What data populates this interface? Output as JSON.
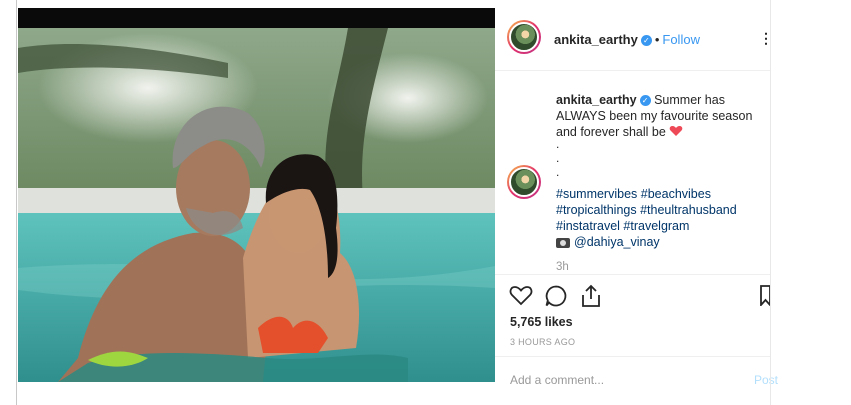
{
  "post": {
    "username": "ankita_earthy",
    "verified": true,
    "follow_label": "Follow",
    "separator": "•",
    "more_glyph": "⋮",
    "caption_text": "Summer has ALWAYS been my favourite season and forever shall be",
    "caption_emoji": "heart-emoji",
    "dots": [
      ".",
      ".",
      "."
    ],
    "hashtags": [
      "#summervibes",
      "#beachvibes",
      "#tropicalthings",
      "#theultrahusband",
      "#instatravel",
      "#travelgram"
    ],
    "photo_credit": "@dahiya_vinay",
    "comment_age": "3h",
    "likes": "5,765 likes",
    "timestamp": "3 HOURS AGO",
    "comment_placeholder": "Add a comment...",
    "post_label": "Post"
  },
  "colors": {
    "link": "#3897f0",
    "hashtag": "#003569",
    "muted": "#999999",
    "heart": "#ed4956",
    "pool": "#4fb8b2"
  },
  "icons": [
    "like-heart-icon",
    "comment-icon",
    "share-icon",
    "bookmark-icon",
    "verified-badge-icon",
    "camera-emoji-icon"
  ]
}
